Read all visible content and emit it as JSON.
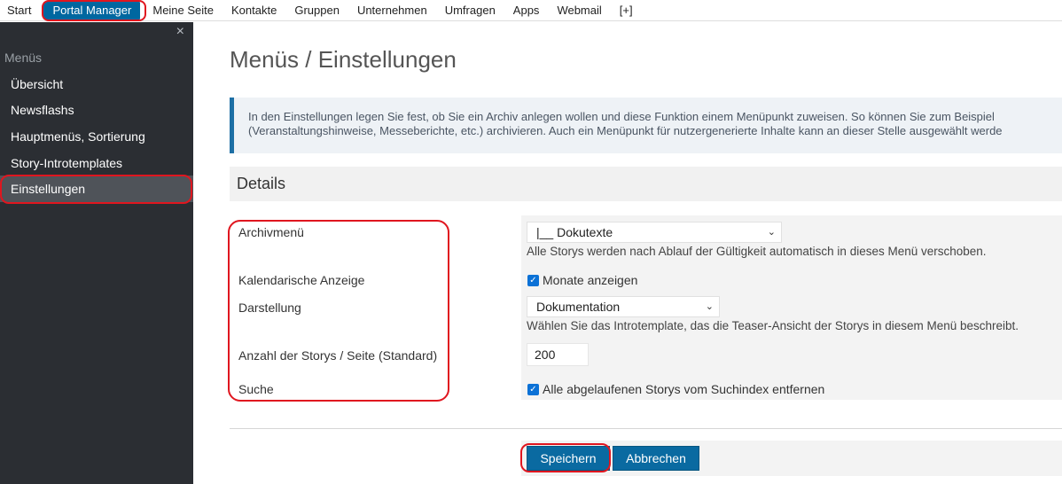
{
  "topnav": {
    "items": [
      "Start",
      "Portal Manager",
      "Meine Seite",
      "Kontakte",
      "Gruppen",
      "Unternehmen",
      "Umfragen",
      "Apps",
      "Webmail",
      "[+]"
    ]
  },
  "sidebar": {
    "close_glyph": "×",
    "heading": "Menüs",
    "items": [
      "Übersicht",
      "Newsflashs",
      "Hauptmenüs, Sortierung",
      "Story-Introtemplates",
      "Einstellungen"
    ]
  },
  "main": {
    "title": "Menüs / Einstellungen",
    "info_line1": "In den Einstellungen legen Sie fest, ob Sie ein Archiv anlegen wollen und diese Funktion einem Menüpunkt zuweisen. So können Sie zum Beispiel",
    "info_line2": "(Veranstaltungshinweise, Messeberichte, etc.) archivieren. Auch ein Menüpunkt für nutzergenerierte Inhalte kann an dieser Stelle ausgewählt werde",
    "details_heading": "Details",
    "labels": {
      "archive": "Archivmenü",
      "calendar": "Kalendarische Anzeige",
      "display": "Darstellung",
      "count": "Anzahl der Storys / Seite (Standard)",
      "search": "Suche"
    },
    "archive_select": "|__ Dokutexte",
    "archive_hint": "Alle Storys werden nach Ablauf der Gültigkeit automatisch in dieses Menü verschoben.",
    "calendar_check": "Monate anzeigen",
    "display_select": "Dokumentation",
    "display_hint": "Wählen Sie das Introtemplate, das die Teaser-Ansicht der Storys in diesem Menü beschreibt.",
    "count_value": "200",
    "search_check": "Alle abgelaufenen Storys vom Suchindex entfernen",
    "save_label": "Speichern",
    "cancel_label": "Abbrechen"
  },
  "colors": {
    "accent": "#0067a0",
    "sidebar_bg": "#2b2e33",
    "highlight": "#e0161f"
  }
}
